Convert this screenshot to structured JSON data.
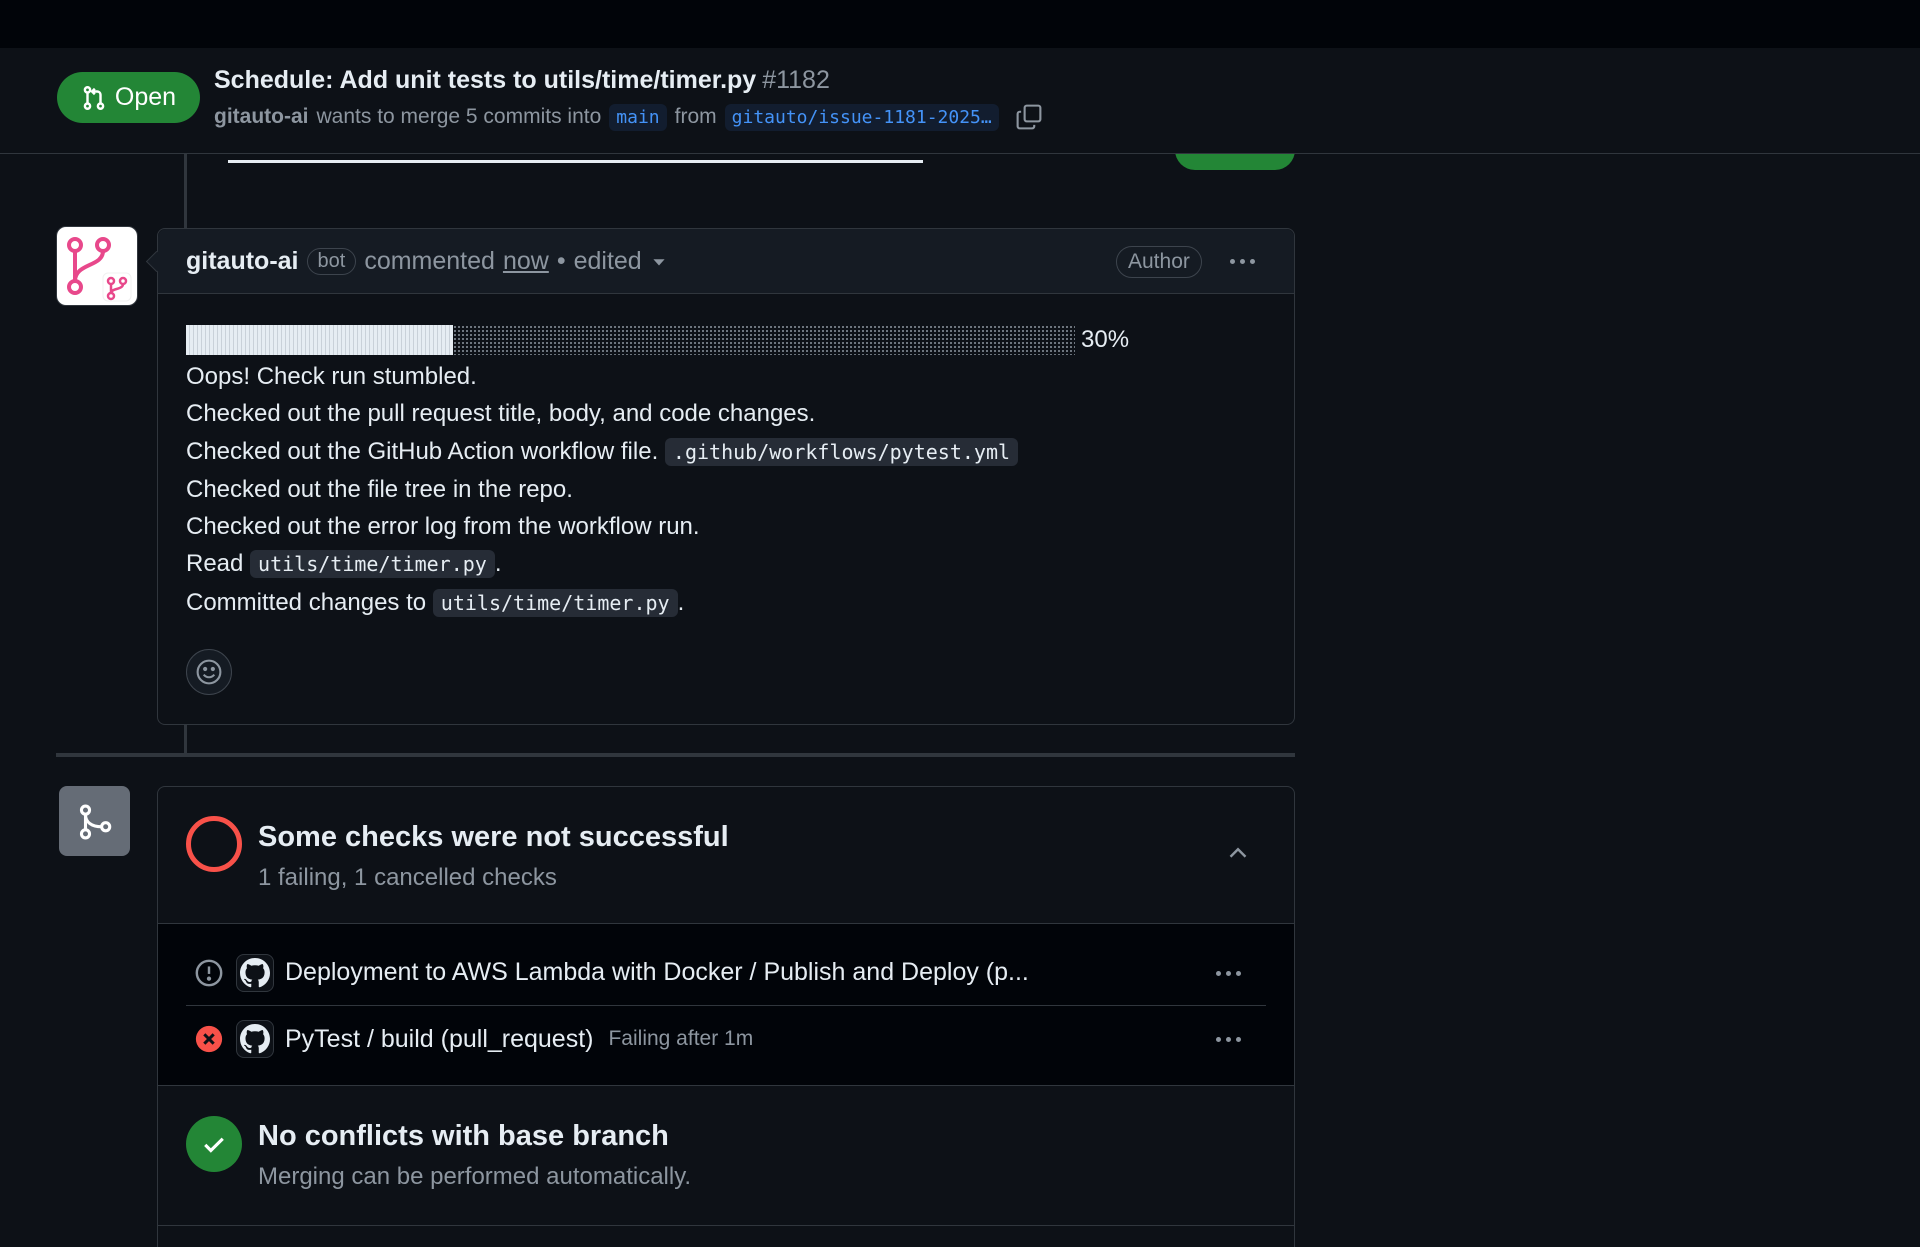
{
  "header": {
    "status": "Open",
    "title": "Schedule: Add unit tests to utils/time/timer.py",
    "number": "#1182",
    "author": "gitauto-ai",
    "merge_text": "wants to merge 5 commits into",
    "base_branch": "main",
    "from_text": "from",
    "head_branch": "gitauto/issue-1181-2025…"
  },
  "comment": {
    "author": "gitauto-ai",
    "bot_label": "bot",
    "commented": "commented",
    "time": "now",
    "separator": "•",
    "edited": "edited",
    "author_badge": "Author",
    "progress_percent": 30,
    "progress_label": "30%",
    "lines": {
      "l1": "Oops! Check run stumbled.",
      "l2": "Checked out the pull request title, body, and code changes.",
      "l3": "Checked out the GitHub Action workflow file.",
      "l3_code": ".github/workflows/pytest.yml",
      "l4": "Checked out the file tree in the repo.",
      "l5": "Checked out the error log from the workflow run.",
      "l6": "Read",
      "l6_code": "utils/time/timer.py",
      "l7": "Committed changes to",
      "l7_code": "utils/time/timer.py",
      "period": "."
    }
  },
  "checks": {
    "title": "Some checks were not successful",
    "subtitle": "1 failing, 1 cancelled checks",
    "items": [
      {
        "name": "Deployment to AWS Lambda with Docker / Publish and Deploy (p...",
        "meta": "",
        "status": "cancelled"
      },
      {
        "name": "PyTest / build (pull_request)",
        "meta": "Failing after 1m",
        "status": "failing"
      }
    ]
  },
  "conflicts": {
    "title": "No conflicts with base branch",
    "subtitle": "Merging can be performed automatically."
  },
  "colors": {
    "open_green": "#238636",
    "fail_red": "#f85149",
    "link_blue": "#4493f8",
    "avatar_pink": "#e8488b"
  }
}
